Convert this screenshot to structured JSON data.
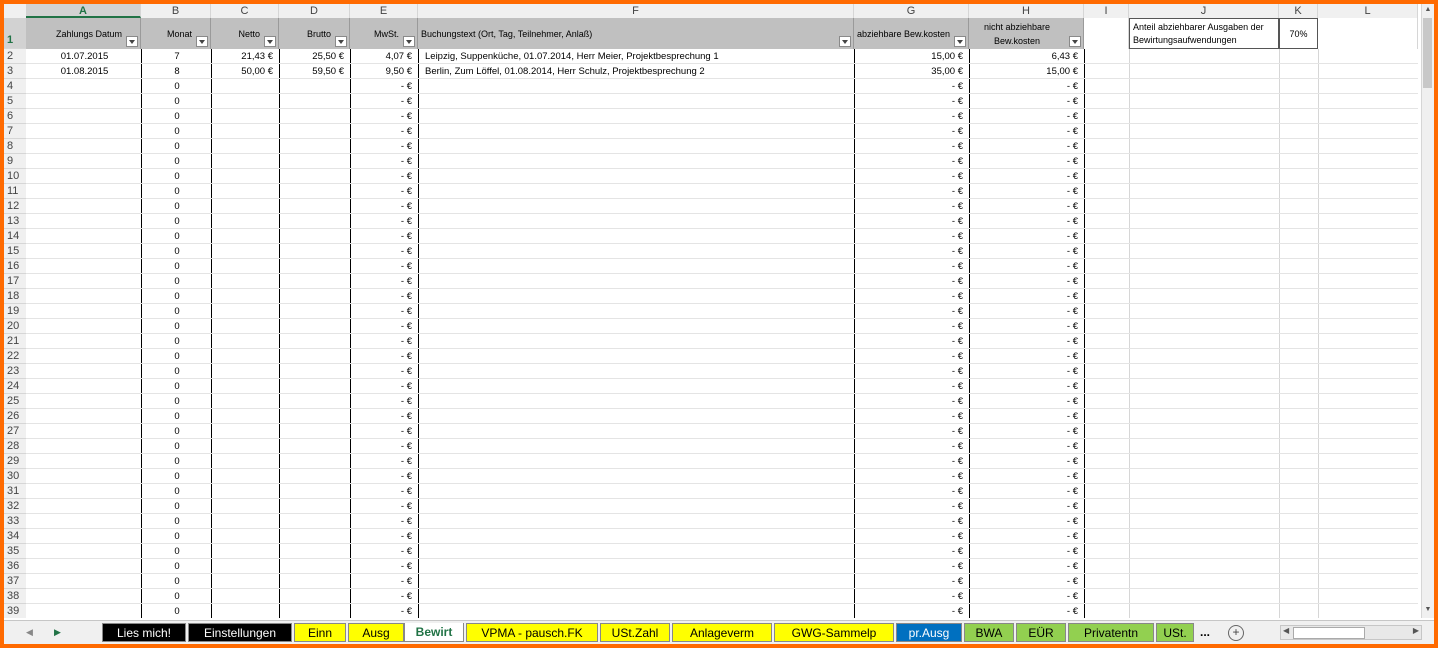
{
  "columns": [
    "A",
    "B",
    "C",
    "D",
    "E",
    "F",
    "G",
    "H",
    "I",
    "J",
    "K",
    "L"
  ],
  "header": {
    "a": "Zahlungs Datum",
    "b": "Monat",
    "c": "Netto",
    "d": "Brutto",
    "e": "MwSt.",
    "f": "Buchungstext (Ort, Tag, Teilnehmer, Anlaß)",
    "g": "abziehbare Bew.kosten",
    "h": "nicht abziehbare Bew.kosten",
    "j": "Anteil abziehbarer Ausgaben der Bewirtungsaufwendungen",
    "k": "70%"
  },
  "rows": [
    {
      "num": "2",
      "date": "01.07.2015",
      "month": "7",
      "netto": "21,43 €",
      "brutto": "25,50 €",
      "mwst": "4,07 €",
      "text": "Leipzig, Suppenküche, 01.07.2014, Herr Meier, Projektbesprechung 1",
      "g": "15,00 €",
      "h": "6,43 €"
    },
    {
      "num": "3",
      "date": "01.08.2015",
      "month": "8",
      "netto": "50,00 €",
      "brutto": "59,50 €",
      "mwst": "9,50 €",
      "text": "Berlin, Zum Löffel, 01.08.2014, Herr Schulz, Projektbesprechung 2",
      "g": "35,00 €",
      "h": "15,00 €"
    },
    {
      "num": "4",
      "date": "",
      "month": "0",
      "netto": "",
      "brutto": "",
      "mwst": "-   €",
      "text": "",
      "g": "-   €",
      "h": "-   €"
    },
    {
      "num": "5",
      "date": "",
      "month": "0",
      "netto": "",
      "brutto": "",
      "mwst": "-   €",
      "text": "",
      "g": "-   €",
      "h": "-   €"
    },
    {
      "num": "6",
      "date": "",
      "month": "0",
      "netto": "",
      "brutto": "",
      "mwst": "-   €",
      "text": "",
      "g": "-   €",
      "h": "-   €"
    },
    {
      "num": "7",
      "date": "",
      "month": "0",
      "netto": "",
      "brutto": "",
      "mwst": "-   €",
      "text": "",
      "g": "-   €",
      "h": "-   €"
    },
    {
      "num": "8",
      "date": "",
      "month": "0",
      "netto": "",
      "brutto": "",
      "mwst": "-   €",
      "text": "",
      "g": "-   €",
      "h": "-   €"
    },
    {
      "num": "9",
      "date": "",
      "month": "0",
      "netto": "",
      "brutto": "",
      "mwst": "-   €",
      "text": "",
      "g": "-   €",
      "h": "-   €"
    },
    {
      "num": "10",
      "date": "",
      "month": "0",
      "netto": "",
      "brutto": "",
      "mwst": "-   €",
      "text": "",
      "g": "-   €",
      "h": "-   €"
    },
    {
      "num": "11",
      "date": "",
      "month": "0",
      "netto": "",
      "brutto": "",
      "mwst": "-   €",
      "text": "",
      "g": "-   €",
      "h": "-   €"
    },
    {
      "num": "12",
      "date": "",
      "month": "0",
      "netto": "",
      "brutto": "",
      "mwst": "-   €",
      "text": "",
      "g": "-   €",
      "h": "-   €"
    },
    {
      "num": "13",
      "date": "",
      "month": "0",
      "netto": "",
      "brutto": "",
      "mwst": "-   €",
      "text": "",
      "g": "-   €",
      "h": "-   €"
    },
    {
      "num": "14",
      "date": "",
      "month": "0",
      "netto": "",
      "brutto": "",
      "mwst": "-   €",
      "text": "",
      "g": "-   €",
      "h": "-   €"
    },
    {
      "num": "15",
      "date": "",
      "month": "0",
      "netto": "",
      "brutto": "",
      "mwst": "-   €",
      "text": "",
      "g": "-   €",
      "h": "-   €"
    },
    {
      "num": "16",
      "date": "",
      "month": "0",
      "netto": "",
      "brutto": "",
      "mwst": "-   €",
      "text": "",
      "g": "-   €",
      "h": "-   €"
    },
    {
      "num": "17",
      "date": "",
      "month": "0",
      "netto": "",
      "brutto": "",
      "mwst": "-   €",
      "text": "",
      "g": "-   €",
      "h": "-   €"
    },
    {
      "num": "18",
      "date": "",
      "month": "0",
      "netto": "",
      "brutto": "",
      "mwst": "-   €",
      "text": "",
      "g": "-   €",
      "h": "-   €"
    },
    {
      "num": "19",
      "date": "",
      "month": "0",
      "netto": "",
      "brutto": "",
      "mwst": "-   €",
      "text": "",
      "g": "-   €",
      "h": "-   €"
    },
    {
      "num": "20",
      "date": "",
      "month": "0",
      "netto": "",
      "brutto": "",
      "mwst": "-   €",
      "text": "",
      "g": "-   €",
      "h": "-   €"
    },
    {
      "num": "21",
      "date": "",
      "month": "0",
      "netto": "",
      "brutto": "",
      "mwst": "-   €",
      "text": "",
      "g": "-   €",
      "h": "-   €"
    },
    {
      "num": "22",
      "date": "",
      "month": "0",
      "netto": "",
      "brutto": "",
      "mwst": "-   €",
      "text": "",
      "g": "-   €",
      "h": "-   €"
    },
    {
      "num": "23",
      "date": "",
      "month": "0",
      "netto": "",
      "brutto": "",
      "mwst": "-   €",
      "text": "",
      "g": "-   €",
      "h": "-   €"
    },
    {
      "num": "24",
      "date": "",
      "month": "0",
      "netto": "",
      "brutto": "",
      "mwst": "-   €",
      "text": "",
      "g": "-   €",
      "h": "-   €"
    },
    {
      "num": "25",
      "date": "",
      "month": "0",
      "netto": "",
      "brutto": "",
      "mwst": "-   €",
      "text": "",
      "g": "-   €",
      "h": "-   €"
    },
    {
      "num": "26",
      "date": "",
      "month": "0",
      "netto": "",
      "brutto": "",
      "mwst": "-   €",
      "text": "",
      "g": "-   €",
      "h": "-   €"
    },
    {
      "num": "27",
      "date": "",
      "month": "0",
      "netto": "",
      "brutto": "",
      "mwst": "-   €",
      "text": "",
      "g": "-   €",
      "h": "-   €"
    },
    {
      "num": "28",
      "date": "",
      "month": "0",
      "netto": "",
      "brutto": "",
      "mwst": "-   €",
      "text": "",
      "g": "-   €",
      "h": "-   €"
    },
    {
      "num": "29",
      "date": "",
      "month": "0",
      "netto": "",
      "brutto": "",
      "mwst": "-   €",
      "text": "",
      "g": "-   €",
      "h": "-   €"
    },
    {
      "num": "30",
      "date": "",
      "month": "0",
      "netto": "",
      "brutto": "",
      "mwst": "-   €",
      "text": "",
      "g": "-   €",
      "h": "-   €"
    },
    {
      "num": "31",
      "date": "",
      "month": "0",
      "netto": "",
      "brutto": "",
      "mwst": "-   €",
      "text": "",
      "g": "-   €",
      "h": "-   €"
    },
    {
      "num": "32",
      "date": "",
      "month": "0",
      "netto": "",
      "brutto": "",
      "mwst": "-   €",
      "text": "",
      "g": "-   €",
      "h": "-   €"
    },
    {
      "num": "33",
      "date": "",
      "month": "0",
      "netto": "",
      "brutto": "",
      "mwst": "-   €",
      "text": "",
      "g": "-   €",
      "h": "-   €"
    },
    {
      "num": "34",
      "date": "",
      "month": "0",
      "netto": "",
      "brutto": "",
      "mwst": "-   €",
      "text": "",
      "g": "-   €",
      "h": "-   €"
    },
    {
      "num": "35",
      "date": "",
      "month": "0",
      "netto": "",
      "brutto": "",
      "mwst": "-   €",
      "text": "",
      "g": "-   €",
      "h": "-   €"
    },
    {
      "num": "36",
      "date": "",
      "month": "0",
      "netto": "",
      "brutto": "",
      "mwst": "-   €",
      "text": "",
      "g": "-   €",
      "h": "-   €"
    },
    {
      "num": "37",
      "date": "",
      "month": "0",
      "netto": "",
      "brutto": "",
      "mwst": "-   €",
      "text": "",
      "g": "-   €",
      "h": "-   €"
    },
    {
      "num": "38",
      "date": "",
      "month": "0",
      "netto": "",
      "brutto": "",
      "mwst": "-   €",
      "text": "",
      "g": "-   €",
      "h": "-   €"
    },
    {
      "num": "39",
      "date": "",
      "month": "0",
      "netto": "",
      "brutto": "",
      "mwst": "-   €",
      "text": "",
      "g": "-   €",
      "h": "-   €"
    }
  ],
  "tabs": [
    {
      "label": "Lies mich!",
      "bg": "#000000",
      "fg": "#ffffff"
    },
    {
      "label": "Einstellungen",
      "bg": "#000000",
      "fg": "#ffffff"
    },
    {
      "label": "Einn",
      "bg": "#ffff00",
      "fg": "#000000"
    },
    {
      "label": "Ausg",
      "bg": "#ffff00",
      "fg": "#000000"
    },
    {
      "label": "Bewirt",
      "bg": "#ffffff",
      "fg": "#217346",
      "active": true
    },
    {
      "label": "VPMA - pausch.FK",
      "bg": "#ffff00",
      "fg": "#000000"
    },
    {
      "label": "USt.Zahl",
      "bg": "#ffff00",
      "fg": "#000000"
    },
    {
      "label": "Anlageverm",
      "bg": "#ffff00",
      "fg": "#000000"
    },
    {
      "label": "GWG-Sammelp",
      "bg": "#ffff00",
      "fg": "#000000"
    },
    {
      "label": "pr.Ausg",
      "bg": "#0070c0",
      "fg": "#ffffff"
    },
    {
      "label": "BWA",
      "bg": "#92d050",
      "fg": "#000000"
    },
    {
      "label": "EÜR",
      "bg": "#92d050",
      "fg": "#000000"
    },
    {
      "label": "Privatentn",
      "bg": "#92d050",
      "fg": "#000000"
    },
    {
      "label": "USt.",
      "bg": "#92d050",
      "fg": "#000000"
    }
  ],
  "tab_more": "...",
  "tab_add": "+",
  "row_header_first": "1"
}
